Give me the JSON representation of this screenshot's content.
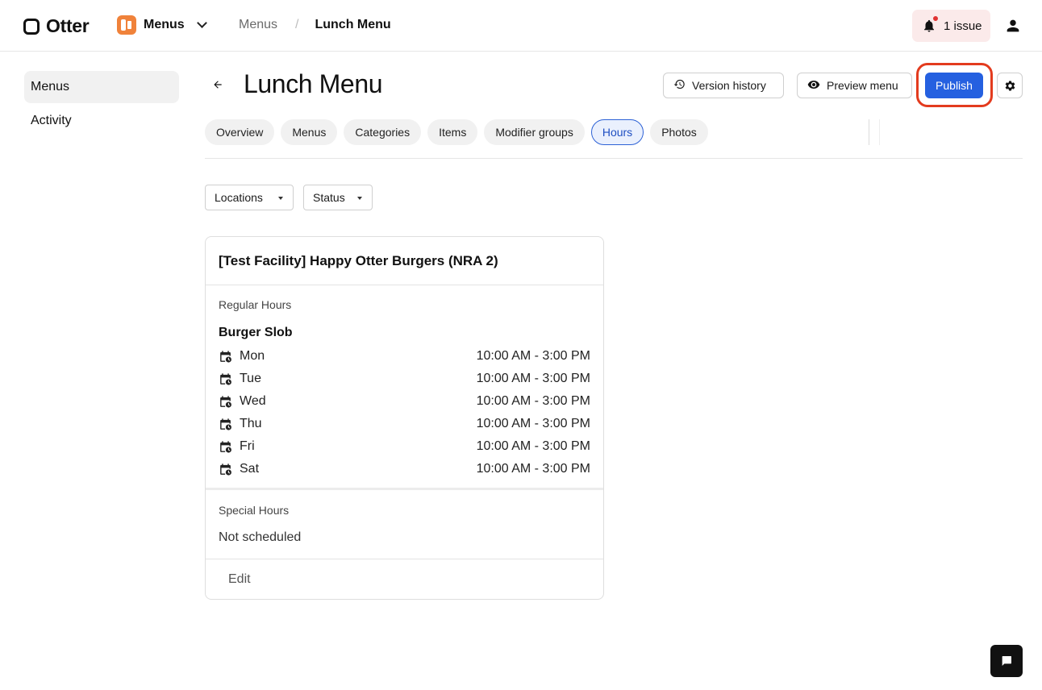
{
  "header": {
    "logo_text": "Otter",
    "app_name": "Menus",
    "breadcrumb": {
      "parent": "Menus",
      "separator": "/",
      "current": "Lunch Menu"
    },
    "issues_label": "1 issue"
  },
  "sidebar": {
    "items": [
      {
        "label": "Menus",
        "active": true
      },
      {
        "label": "Activity",
        "active": false
      }
    ]
  },
  "page": {
    "title": "Lunch Menu",
    "version_history_label": "Version history",
    "preview_label": "Preview menu",
    "publish_label": "Publish"
  },
  "tabs": [
    {
      "label": "Overview"
    },
    {
      "label": "Menus"
    },
    {
      "label": "Categories"
    },
    {
      "label": "Items"
    },
    {
      "label": "Modifier groups"
    },
    {
      "label": "Hours",
      "active": true
    },
    {
      "label": "Photos"
    }
  ],
  "filters": {
    "locations": "Locations",
    "status": "Status"
  },
  "card": {
    "title": "[Test Facility] Happy Otter Burgers (NRA 2)",
    "regular_label": "Regular Hours",
    "group_name": "Burger Slob",
    "hours": [
      {
        "day": "Mon",
        "time": "10:00 AM - 3:00 PM"
      },
      {
        "day": "Tue",
        "time": "10:00 AM - 3:00 PM"
      },
      {
        "day": "Wed",
        "time": "10:00 AM - 3:00 PM"
      },
      {
        "day": "Thu",
        "time": "10:00 AM - 3:00 PM"
      },
      {
        "day": "Fri",
        "time": "10:00 AM - 3:00 PM"
      },
      {
        "day": "Sat",
        "time": "10:00 AM - 3:00 PM"
      }
    ],
    "special_label": "Special Hours",
    "special_value": "Not scheduled",
    "edit_label": "Edit"
  },
  "colors": {
    "primary": "#2560e0",
    "highlight_ring": "#e33b1e",
    "app_icon": "#f0823a",
    "issue_bg": "#fbeaea",
    "active_tab_border": "#2d62d6"
  }
}
